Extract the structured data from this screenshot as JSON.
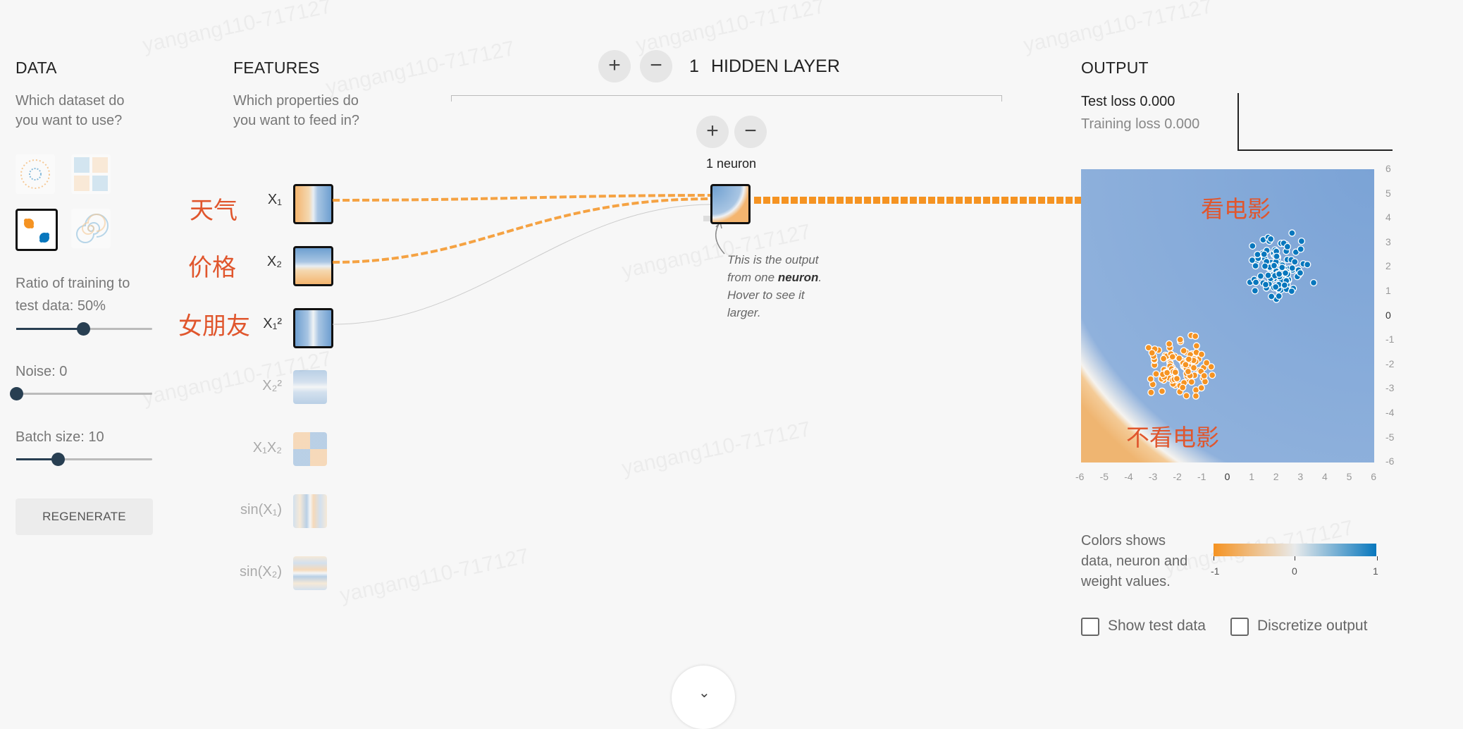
{
  "data_panel": {
    "title": "DATA",
    "subtitle_line1": "Which dataset do",
    "subtitle_line2": "you want to use?",
    "ratio_label_line1": "Ratio of training to",
    "ratio_label_line2": "test data:  50%",
    "ratio_value_percent": 50,
    "noise_label": "Noise:  0",
    "noise_value": 0,
    "batch_label": "Batch size:  10",
    "batch_value": 10,
    "regenerate_label": "REGENERATE"
  },
  "features_panel": {
    "title": "FEATURES",
    "subtitle_line1": "Which properties do",
    "subtitle_line2": "you want to feed in?",
    "annotations": [
      "天气",
      "价格",
      "女朋友"
    ],
    "features": [
      {
        "label": "X₁",
        "active": true
      },
      {
        "label": "X₂",
        "active": true
      },
      {
        "label": "X₁²",
        "active": true
      },
      {
        "label": "X₂²",
        "active": false
      },
      {
        "label": "X₁X₂",
        "active": false
      },
      {
        "label": "sin(X₁)",
        "active": false
      },
      {
        "label": "sin(X₂)",
        "active": false
      }
    ]
  },
  "network": {
    "add_layer_symbol": "+",
    "remove_layer_symbol": "−",
    "layer_count": "1",
    "hidden_layer_label": "HIDDEN LAYER",
    "add_neuron_symbol": "+",
    "remove_neuron_symbol": "−",
    "neuron_count_label": "1 neuron",
    "tooltip_line1": "This is the output",
    "tooltip_line2_pre": "from one ",
    "tooltip_line2_bold": "neuron",
    "tooltip_line2_post": ".",
    "tooltip_line3": "Hover to see it",
    "tooltip_line4": "larger."
  },
  "output_panel": {
    "title": "OUTPUT",
    "test_loss": "Test loss 0.000",
    "training_loss": "Training loss 0.000",
    "region_blue_label": "看电影",
    "region_orange_label": "不看电影",
    "x_ticks": [
      "-6",
      "-5",
      "-4",
      "-3",
      "-2",
      "-1",
      "0",
      "1",
      "2",
      "3",
      "4",
      "5",
      "6"
    ],
    "y_ticks": [
      "6",
      "5",
      "4",
      "3",
      "2",
      "1",
      "0",
      "-1",
      "-2",
      "-3",
      "-4",
      "-5",
      "-6"
    ],
    "legend_text_line1": "Colors shows",
    "legend_text_line2": "data, neuron and",
    "legend_text_line3": "weight values.",
    "legend_ticks": [
      "-1",
      "0",
      "1"
    ],
    "show_test_data_label": "Show test data",
    "show_test_data_checked": false,
    "discretize_label": "Discretize output",
    "discretize_checked": false
  },
  "watermark_text": "yangang110-717127",
  "colors": {
    "orange": "#f59322",
    "blue": "#0877bd",
    "accent_red": "#e0562d",
    "slider_dark": "#283f52"
  }
}
